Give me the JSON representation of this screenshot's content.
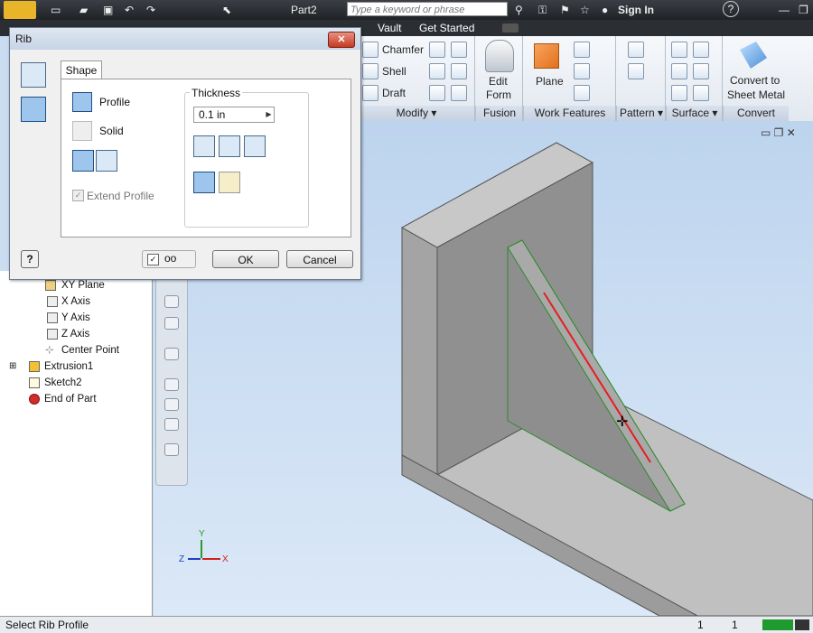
{
  "titlebar": {
    "doc_name": "Part2",
    "search_placeholder": "Type a keyword or phrase",
    "sign_in": "Sign In",
    "help": "?"
  },
  "tabs": [
    "Vault",
    "Get Started"
  ],
  "ribbon": {
    "modify": {
      "chamfer": "Chamfer",
      "shell": "Shell",
      "draft": "Draft",
      "label": "Modify"
    },
    "fusion": {
      "edit_form": "Edit",
      "edit_form2": "Form",
      "label": "Fusion"
    },
    "work_features": {
      "plane": "Plane",
      "label": "Work Features"
    },
    "pattern": {
      "label": "Pattern"
    },
    "surface": {
      "label": "Surface"
    },
    "convert": {
      "line1": "Convert to",
      "line2": "Sheet Metal",
      "label": "Convert"
    }
  },
  "dialog": {
    "title": "Rib",
    "tab_shape": "Shape",
    "profile": "Profile",
    "solid": "Solid",
    "extend_profile": "Extend Profile",
    "thickness_label": "Thickness",
    "thickness_value": "0.1 in",
    "ok": "OK",
    "cancel": "Cancel",
    "help": "?"
  },
  "browser": {
    "items": [
      {
        "label": "XY Plane"
      },
      {
        "label": "X Axis"
      },
      {
        "label": "Y Axis"
      },
      {
        "label": "Z Axis"
      },
      {
        "label": "Center Point"
      },
      {
        "label": "Extrusion1"
      },
      {
        "label": "Sketch2"
      },
      {
        "label": "End of Part"
      }
    ]
  },
  "axes": {
    "x": "X",
    "y": "Y",
    "z": "Z"
  },
  "status": {
    "text": "Select Rib Profile",
    "count1": "1",
    "count2": "1"
  },
  "colors": {
    "accent": "#2f6fb8",
    "rib_line": "#e02020",
    "model_gray": "#9a9a9a"
  }
}
